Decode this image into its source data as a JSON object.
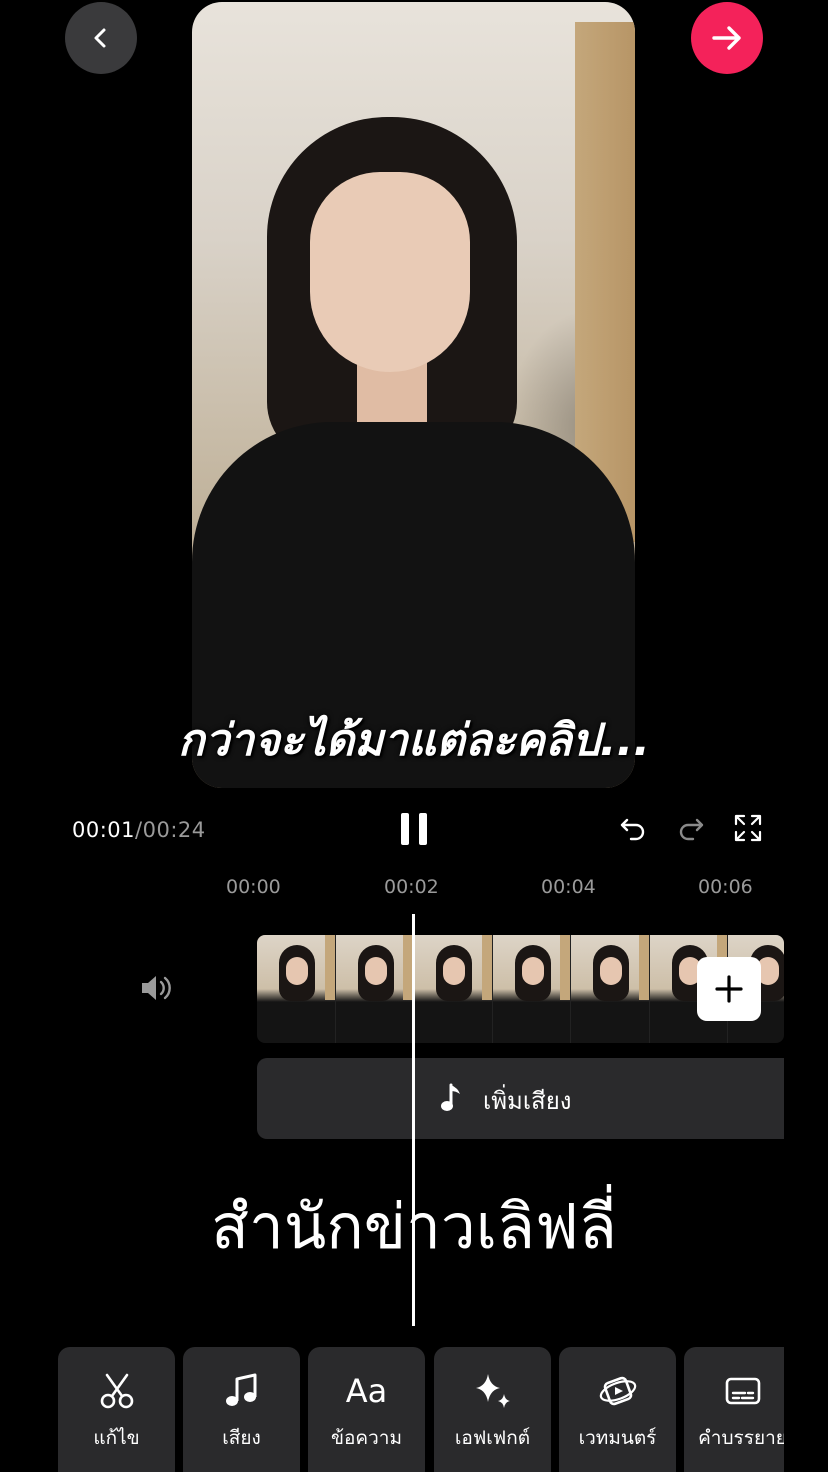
{
  "header": {
    "back_icon": "chevron-left-icon",
    "next_icon": "arrow-right-icon",
    "next_color": "#f4225a"
  },
  "preview": {
    "caption": "กว่าจะได้มาแต่ละคลิป..."
  },
  "playback": {
    "current_time": "00:01",
    "separator": "/",
    "duration": "00:24",
    "pause_icon": "pause-icon",
    "undo_icon": "undo-icon",
    "redo_icon": "redo-icon",
    "fullscreen_icon": "fullscreen-icon"
  },
  "timeline": {
    "ruler": [
      "00:00",
      "00:02",
      "00:04",
      "00:06"
    ],
    "volume_icon": "volume-icon",
    "add_clip_icon": "plus-icon",
    "add_audio_label": "เพิ่มเสียง"
  },
  "watermark": "สำนักข่าวเลิฟลี่",
  "toolbar": {
    "items": [
      {
        "label": "แก้ไข",
        "icon": "scissors-icon"
      },
      {
        "label": "เสียง",
        "icon": "music-note-icon"
      },
      {
        "label": "ข้อความ",
        "icon": "text-icon",
        "glyph": "Aa"
      },
      {
        "label": "เอฟเฟกต์",
        "icon": "sparkle-icon"
      },
      {
        "label": "เวทมนตร์",
        "icon": "magic-icon"
      },
      {
        "label": "คำบรรยาย",
        "icon": "captions-icon"
      }
    ]
  }
}
